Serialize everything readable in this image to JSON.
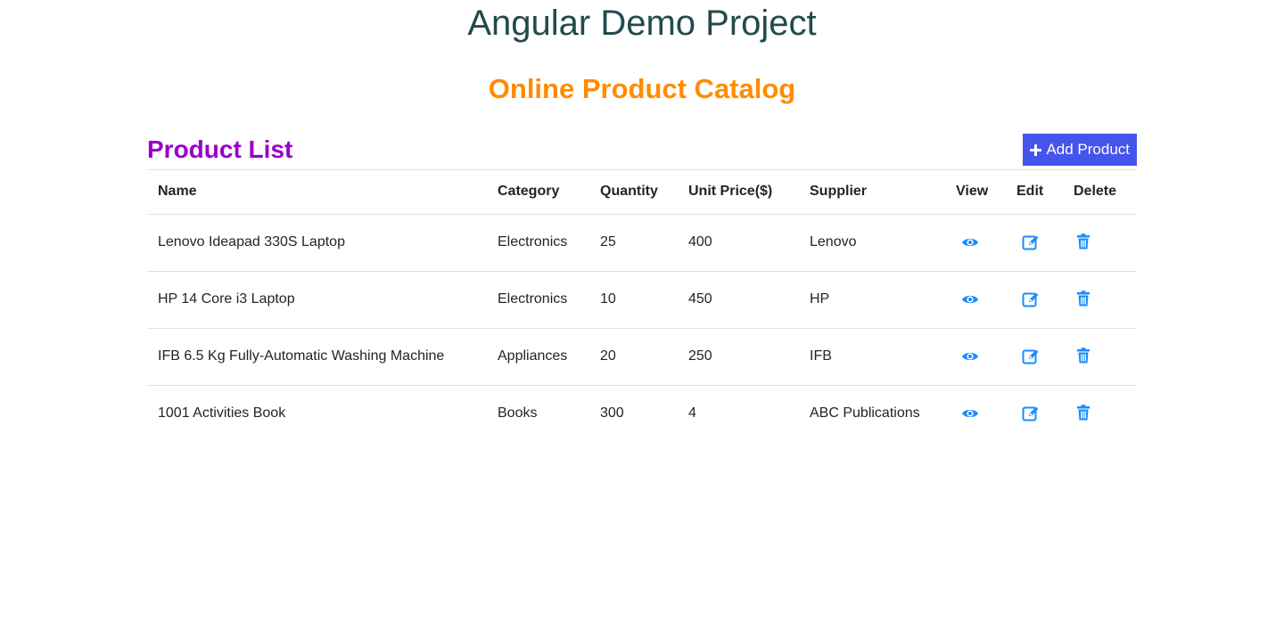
{
  "header": {
    "title": "Angular Demo Project",
    "subtitle": "Online Product Catalog"
  },
  "product_list": {
    "title": "Product List",
    "add_button_label": "Add Product",
    "add_button_icon": "plus-icon",
    "accent_color": "#4554ec",
    "action_icon_color": "#1a8cff",
    "columns": [
      "Name",
      "Category",
      "Quantity",
      "Unit Price($)",
      "Supplier",
      "View",
      "Edit",
      "Delete"
    ],
    "rows": [
      {
        "name": "Lenovo Ideapad 330S Laptop",
        "category": "Electronics",
        "quantity": "25",
        "unit_price": "400",
        "supplier": "Lenovo"
      },
      {
        "name": "HP 14 Core i3 Laptop",
        "category": "Electronics",
        "quantity": "10",
        "unit_price": "450",
        "supplier": "HP"
      },
      {
        "name": "IFB 6.5 Kg Fully-Automatic Washing Machine",
        "category": "Appliances",
        "quantity": "20",
        "unit_price": "250",
        "supplier": "IFB"
      },
      {
        "name": "1001 Activities Book",
        "category": "Books",
        "quantity": "300",
        "unit_price": "4",
        "supplier": "ABC Publications"
      }
    ],
    "row_icons": {
      "view": "eye-icon",
      "edit": "edit-icon",
      "delete": "trash-icon"
    }
  }
}
